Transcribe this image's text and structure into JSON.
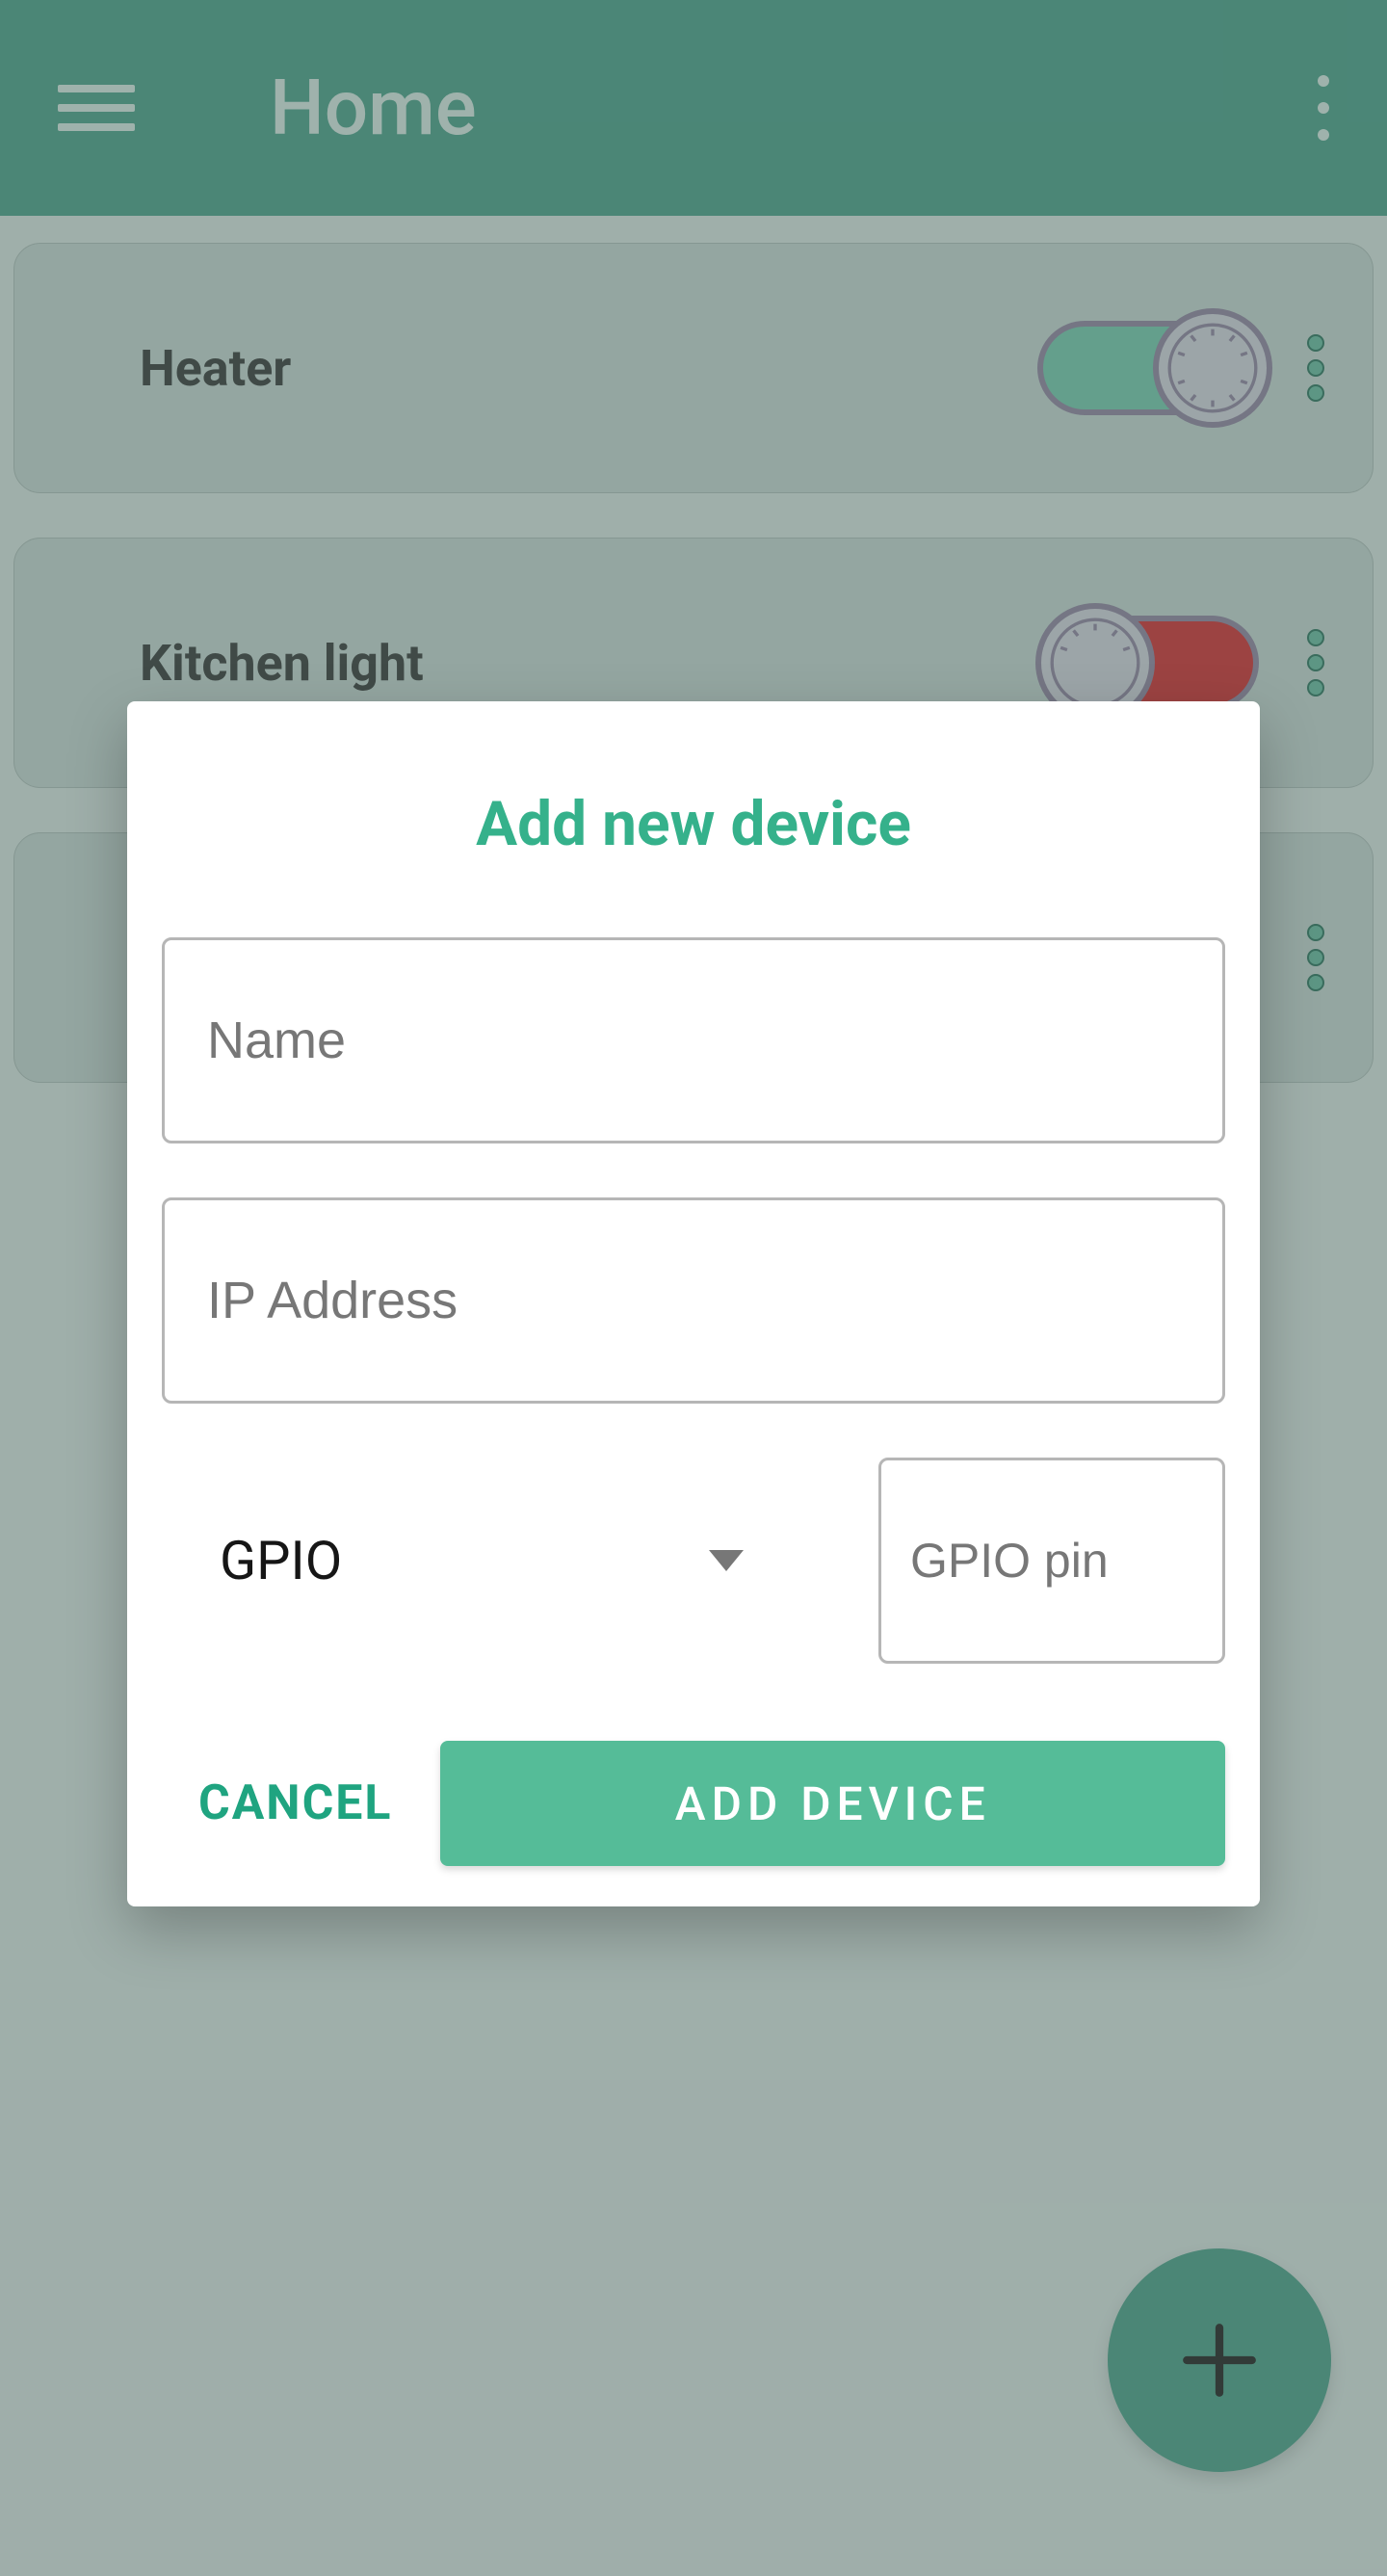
{
  "appbar": {
    "title": "Home"
  },
  "devices": [
    {
      "name": "Heater",
      "state": "on"
    },
    {
      "name": "Kitchen light",
      "state": "off"
    },
    {
      "name": "",
      "state": ""
    }
  ],
  "dialog": {
    "title": "Add new device",
    "name_placeholder": "Name",
    "name_value": "",
    "ip_placeholder": "IP Address",
    "ip_value": "",
    "gpio_select": {
      "selected": "GPIO"
    },
    "gpio_pin_placeholder": "GPIO pin",
    "gpio_pin_value": "",
    "cancel_label": "CANCEL",
    "add_label": "ADD DEVICE"
  },
  "colors": {
    "accent": "#35b18b",
    "primary_button": "#55bc98",
    "appbar": "#3f9a82",
    "off_track": "#d22023"
  }
}
